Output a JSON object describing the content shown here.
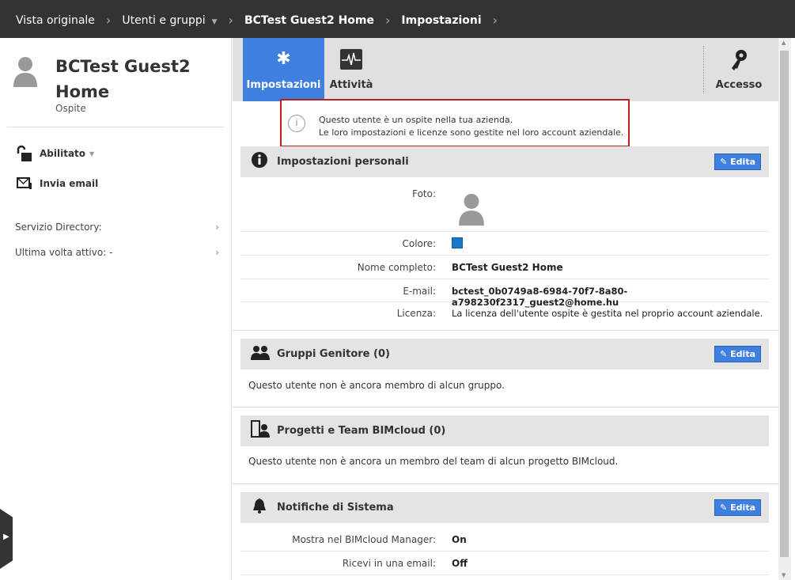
{
  "breadcrumb": [
    "Vista originale",
    "Utenti e gruppi",
    "BCTest Guest2 Home",
    "Impostazioni"
  ],
  "user": {
    "name": "BCTest Guest2 Home",
    "role": "Ospite"
  },
  "sidebar": {
    "status": "Abilitato",
    "send_email": "Invia email",
    "directory": "Servizio Directory:",
    "last_active": "Ultima volta attivo: -"
  },
  "tabs": {
    "settings": "Impostazioni",
    "activity": "Attività",
    "access": "Accesso"
  },
  "notice": {
    "line1": "Questo utente è un ospite nella tua azienda.",
    "line2": "Le loro impostazioni e licenze sono gestite nel loro account aziendale."
  },
  "edit_label": "Edita",
  "personal": {
    "title": "Impostazioni personali",
    "photo_label": "Foto:",
    "color_label": "Colore:",
    "color": "#1a78c8",
    "fullname_label": "Nome completo:",
    "fullname": "BCTest Guest2 Home",
    "email_label": "E-mail:",
    "email": "bctest_0b0749a8-6984-70f7-8a80-a798230f2317_guest2@home.hu",
    "license_label": "Licenza:",
    "license": "La licenza dell'utente ospite è gestita nel proprio account aziendale."
  },
  "groups": {
    "title": "Gruppi Genitore (0)",
    "text": "Questo utente non è ancora membro di alcun gruppo."
  },
  "projects": {
    "title": "Progetti e Team BIMcloud (0)",
    "text": "Questo utente non è ancora un membro del team di alcun progetto BIMcloud."
  },
  "notifications": {
    "title": "Notifiche di Sistema",
    "manager_label": "Mostra nel BIMcloud Manager:",
    "manager": "On",
    "email_label": "Ricevi in una email:",
    "email": "Off"
  }
}
